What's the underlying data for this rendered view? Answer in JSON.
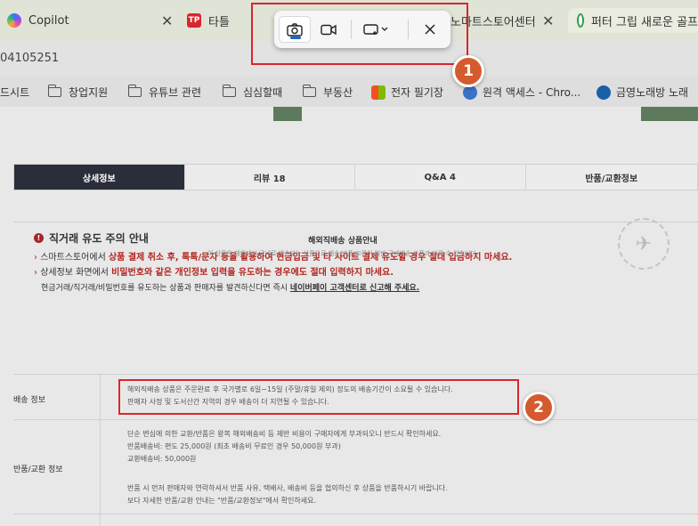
{
  "browser": {
    "tabs": [
      {
        "label": "Copilot",
        "favicon": "copilot-icon"
      },
      {
        "label": "타틀",
        "favicon": "tp-icon"
      },
      {
        "label": "노마트스토어센터"
      },
      {
        "label": "퍼터 그립 새로운 골프"
      }
    ],
    "url": "04105251",
    "bookmarks": [
      {
        "label": "드시트"
      },
      {
        "label": "창업지원"
      },
      {
        "label": "유튜브 관련"
      },
      {
        "label": "심심할때"
      },
      {
        "label": "부동산"
      },
      {
        "label": "전자 필기장"
      },
      {
        "label": "원격 액세스 - Chro..."
      },
      {
        "label": "금영노래방 노래"
      }
    ]
  },
  "product_tabs": [
    "상세정보",
    "리뷰 18",
    "Q&A 4",
    "반품/교환정보"
  ],
  "notice": {
    "title": "직거래 유도 주의 안내",
    "lines": [
      {
        "a": "스마트스토어에서 ",
        "b": "상품 결제 취소 후, 톡톡/문자 등을 활용하여 현금입금 및 타 사이트 결제 유도할 경우 절대 입금하지 마세요.",
        "c": ""
      },
      {
        "a": "상세정보 화면에서 ",
        "b": "비밀번호와 같은 개인정보 입력을 유도하는 경우에도 절대 입력하지 마세요.",
        "c": ""
      },
      {
        "a": "현금거래/직거래/비밀번호를 유도하는 상품과 판매자를 발견하신다면 즉시 ",
        "b": "네이버페이 고객센터로 신고해 주세요.",
        "c": ""
      }
    ]
  },
  "shipping": {
    "title": "해외직배송 상품안내",
    "subtitle": "이 상품은 해외에서 국내로 배송되는 상품으로 배송/반품/교환이 일반 국내배송 상품과 다를 수 있습니다.",
    "delivery_label": "배송 정보",
    "delivery_lines": [
      "해외직배송 상품은 주문완료 후 국가별로 6일~15일 (주말/휴일 제외) 정도의 배송기간이 소요될 수 있습니다.",
      "판매자 사정 및 도서산간 지역의 경우 배송이 더 지연될 수 있습니다."
    ],
    "return_label": "반품/교환 정보",
    "return_lines": [
      "단순 변심에 의한 교환/반품은 왕복 해외배송비 등 제반 비용이 구매자에게 부과되오니 반드시 확인하세요.",
      "반품배송비: 편도 25,000원 (최초 배송비 무료인 경우 50,000원 부과)",
      "교환배송비: 50,000원"
    ],
    "return_lines2": [
      "반품 시 먼저 판매자와 연락하셔서 반품 사유, 택배사, 배송비 등을 협의하신 후 상품을 반품하시기 바랍니다.",
      "보다 자세한 반품/교환 안내는 \"반품/교환정보\"에서 확인하세요."
    ]
  },
  "annotations": {
    "badge1": "1",
    "badge2": "2"
  },
  "colors": {
    "highlight": "#d9262c",
    "badge": "#d55a2d",
    "accent": "#1a66c8"
  }
}
